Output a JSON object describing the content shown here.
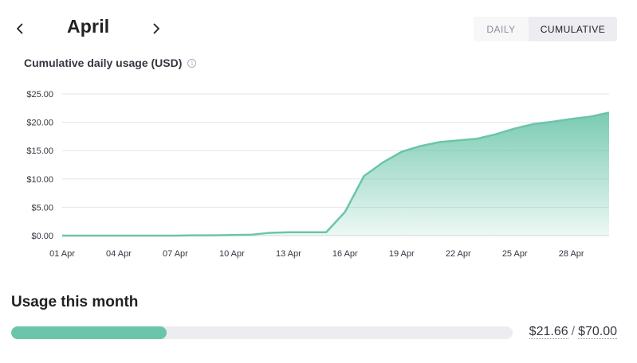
{
  "header": {
    "month": "April",
    "toggle": {
      "daily_label": "DAILY",
      "cumulative_label": "CUMULATIVE",
      "selected": "cumulative"
    }
  },
  "chart_title": "Cumulative daily usage (USD)",
  "usage": {
    "title": "Usage this month",
    "used": "$21.66",
    "limit": "$70.00",
    "fraction": 0.3094
  },
  "colors": {
    "accent": "#6bc5aa",
    "line": "#6bc5aa",
    "grid": "#e5e5e9"
  },
  "icons": {
    "prev": "chevron-left-icon",
    "next": "chevron-right-icon",
    "info": "info-icon"
  },
  "chart_data": {
    "type": "area",
    "title": "Cumulative daily usage (USD)",
    "xlabel": "",
    "ylabel": "",
    "ylim": [
      0,
      25
    ],
    "yticks": [
      0,
      5,
      10,
      15,
      20,
      25
    ],
    "ytick_labels": [
      "$0.00",
      "$5.00",
      "$10.00",
      "$15.00",
      "$20.00",
      "$25.00"
    ],
    "xtick_labels": [
      "01 Apr",
      "04 Apr",
      "07 Apr",
      "10 Apr",
      "13 Apr",
      "16 Apr",
      "19 Apr",
      "22 Apr",
      "25 Apr",
      "28 Apr"
    ],
    "xtick_days": [
      1,
      4,
      7,
      10,
      13,
      16,
      19,
      22,
      25,
      28
    ],
    "grid": true,
    "series": [
      {
        "x": [
          1,
          2,
          3,
          4,
          5,
          6,
          7,
          8,
          9,
          10,
          11,
          12,
          13,
          14,
          15,
          16,
          17,
          18,
          19,
          20,
          21,
          22,
          23,
          24,
          25,
          26,
          27,
          28,
          29,
          30
        ],
        "y": [
          0.0,
          0.0,
          0.0,
          0.0,
          0.0,
          0.0,
          0.0,
          0.05,
          0.05,
          0.1,
          0.15,
          0.5,
          0.6,
          0.6,
          0.6,
          4.2,
          10.5,
          12.9,
          14.8,
          15.8,
          16.5,
          16.8,
          17.1,
          17.9,
          18.9,
          19.7,
          20.1,
          20.6,
          21.0,
          21.7
        ]
      }
    ]
  }
}
